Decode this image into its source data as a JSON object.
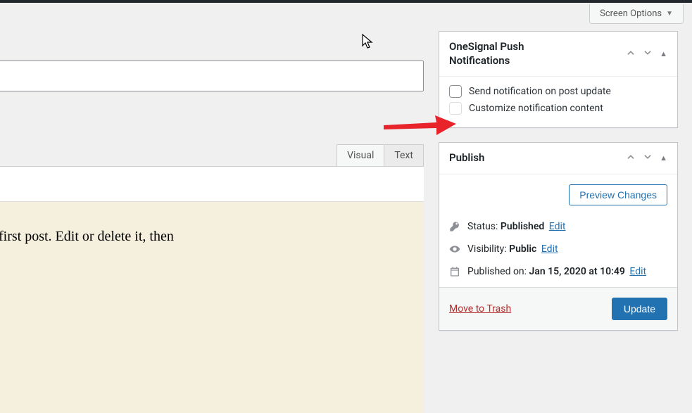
{
  "screen_options": {
    "label": "Screen Options"
  },
  "editor": {
    "title_value": "",
    "tabs": {
      "visual": "Visual",
      "text": "Text"
    },
    "content": "first post. Edit or delete it, then"
  },
  "onesignal": {
    "title": "OneSignal Push Notifications",
    "opt_send": "Send notification on post update",
    "opt_customize": "Customize notification content"
  },
  "publish": {
    "title": "Publish",
    "preview": "Preview Changes",
    "status_label": "Status:",
    "status_value": "Published",
    "visibility_label": "Visibility:",
    "visibility_value": "Public",
    "published_label": "Published on:",
    "published_value": "Jan 15, 2020 at 10:49",
    "edit": "Edit",
    "trash": "Move to Trash",
    "update": "Update"
  }
}
